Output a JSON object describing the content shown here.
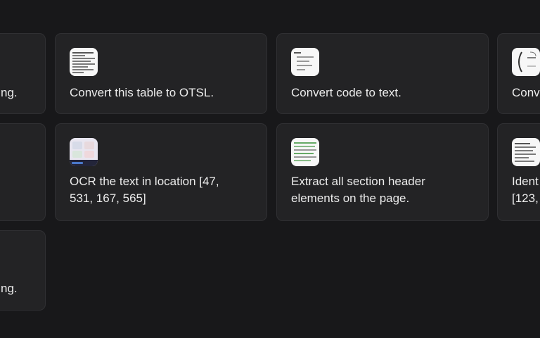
{
  "cards": {
    "r1c0": {
      "label": "ng."
    },
    "r1c1": {
      "label": "Convert this table to OTSL."
    },
    "r1c2": {
      "label": "Convert code to text."
    },
    "r1c3": {
      "label": "Conv"
    },
    "r2c0": {
      "label": ""
    },
    "r2c1": {
      "line1": "OCR the text in location [47,",
      "line2": "531, 167, 565]"
    },
    "r2c2": {
      "line1": "Extract all section header",
      "line2": "elements on the page."
    },
    "r2c3": {
      "line1": "Ident",
      "line2": "[123,"
    },
    "r3c0": {
      "label": "ng."
    }
  },
  "colors": {
    "background": "#18181a",
    "card": "#232325",
    "card_border": "#303033",
    "text": "#ececec",
    "thumb": "#f7f7f7"
  }
}
